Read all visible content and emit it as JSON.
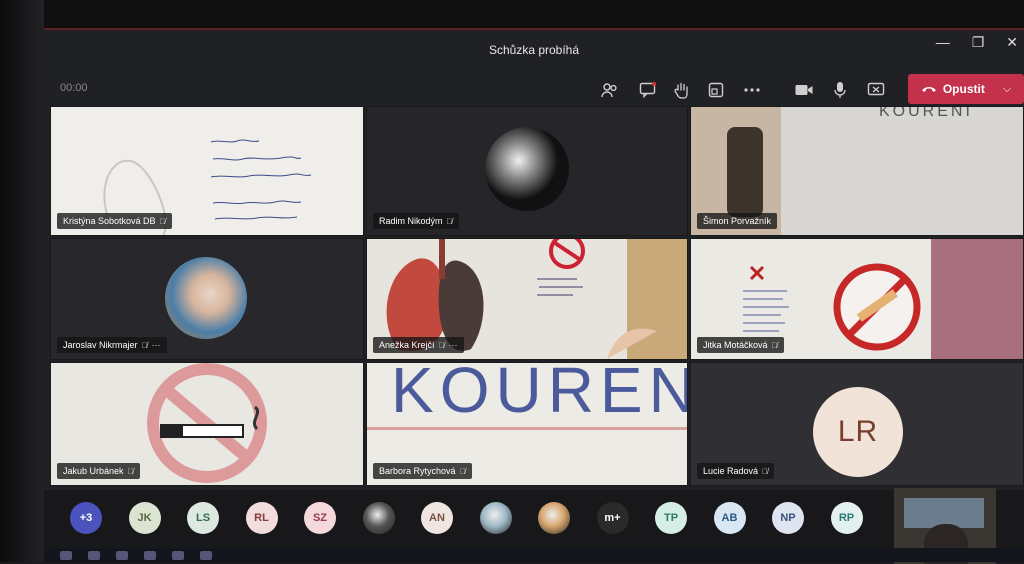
{
  "window": {
    "title": "Schůzka probíhá",
    "timer": "00:00",
    "controls": {
      "minimize": "—",
      "maximize": "❐",
      "close": "✕"
    }
  },
  "toolbar": {
    "icons": [
      "participants-icon",
      "chat-icon",
      "raise-hand-icon",
      "rooms-icon",
      "more-icon",
      "camera-icon",
      "mic-icon",
      "share-icon"
    ],
    "leave_label": "Opustit",
    "leave_color": "#c4314b"
  },
  "participants": [
    {
      "name": "Kristýna Sobotková DB",
      "tile": "drawing-text"
    },
    {
      "name": "Radim Nikodým",
      "tile": "avatar-photo"
    },
    {
      "name": "Šimon Porvažník",
      "tile": "room-video"
    },
    {
      "name": "Jaroslav Nikrmajer",
      "tile": "avatar-photo"
    },
    {
      "name": "Anežka Krejčí",
      "tile": "drawing-lungs"
    },
    {
      "name": "Jitka Motáčková",
      "tile": "drawing-nosmoking"
    },
    {
      "name": "Jakub Urbánek",
      "tile": "drawing-cigarette"
    },
    {
      "name": "Barbora Rytychová",
      "tile": "drawing-koureni"
    },
    {
      "name": "Lucie Radová",
      "tile": "initials",
      "initials": "LR"
    }
  ],
  "tile_texts": {
    "koureni_word": "KOUREN",
    "koureni_top": "KOURENI"
  },
  "roster": [
    {
      "label": "+3",
      "bg": "#4b53bc",
      "fg": "#ffffff"
    },
    {
      "label": "JK",
      "bg": "#dbe3d1",
      "fg": "#5b6b3d"
    },
    {
      "label": "LS",
      "bg": "#dde8e1",
      "fg": "#356b4e"
    },
    {
      "label": "RL",
      "bg": "#f2dcdc",
      "fg": "#8a3b3b"
    },
    {
      "label": "SZ",
      "bg": "#f3d9dc",
      "fg": "#9b3a4c"
    },
    {
      "label": "",
      "bg": "#555555",
      "fg": "#ffffff",
      "photo": true
    },
    {
      "label": "AN",
      "bg": "#f0e6e1",
      "fg": "#7c5143"
    },
    {
      "label": "",
      "bg": "#9fb8c6",
      "fg": "#ffffff",
      "photo": true
    },
    {
      "label": "",
      "bg": "#d6a46c",
      "fg": "#ffffff",
      "photo": true
    },
    {
      "label": "m+",
      "bg": "#2a2a2a",
      "fg": "#ffffff"
    },
    {
      "label": "TP",
      "bg": "#d6efe6",
      "fg": "#2e7a5c"
    },
    {
      "label": "AB",
      "bg": "#d9e6f3",
      "fg": "#2b5b86"
    },
    {
      "label": "NP",
      "bg": "#dfe5f0",
      "fg": "#38507a"
    },
    {
      "label": "RP",
      "bg": "#e2f1ef",
      "fg": "#2c7a70"
    }
  ]
}
